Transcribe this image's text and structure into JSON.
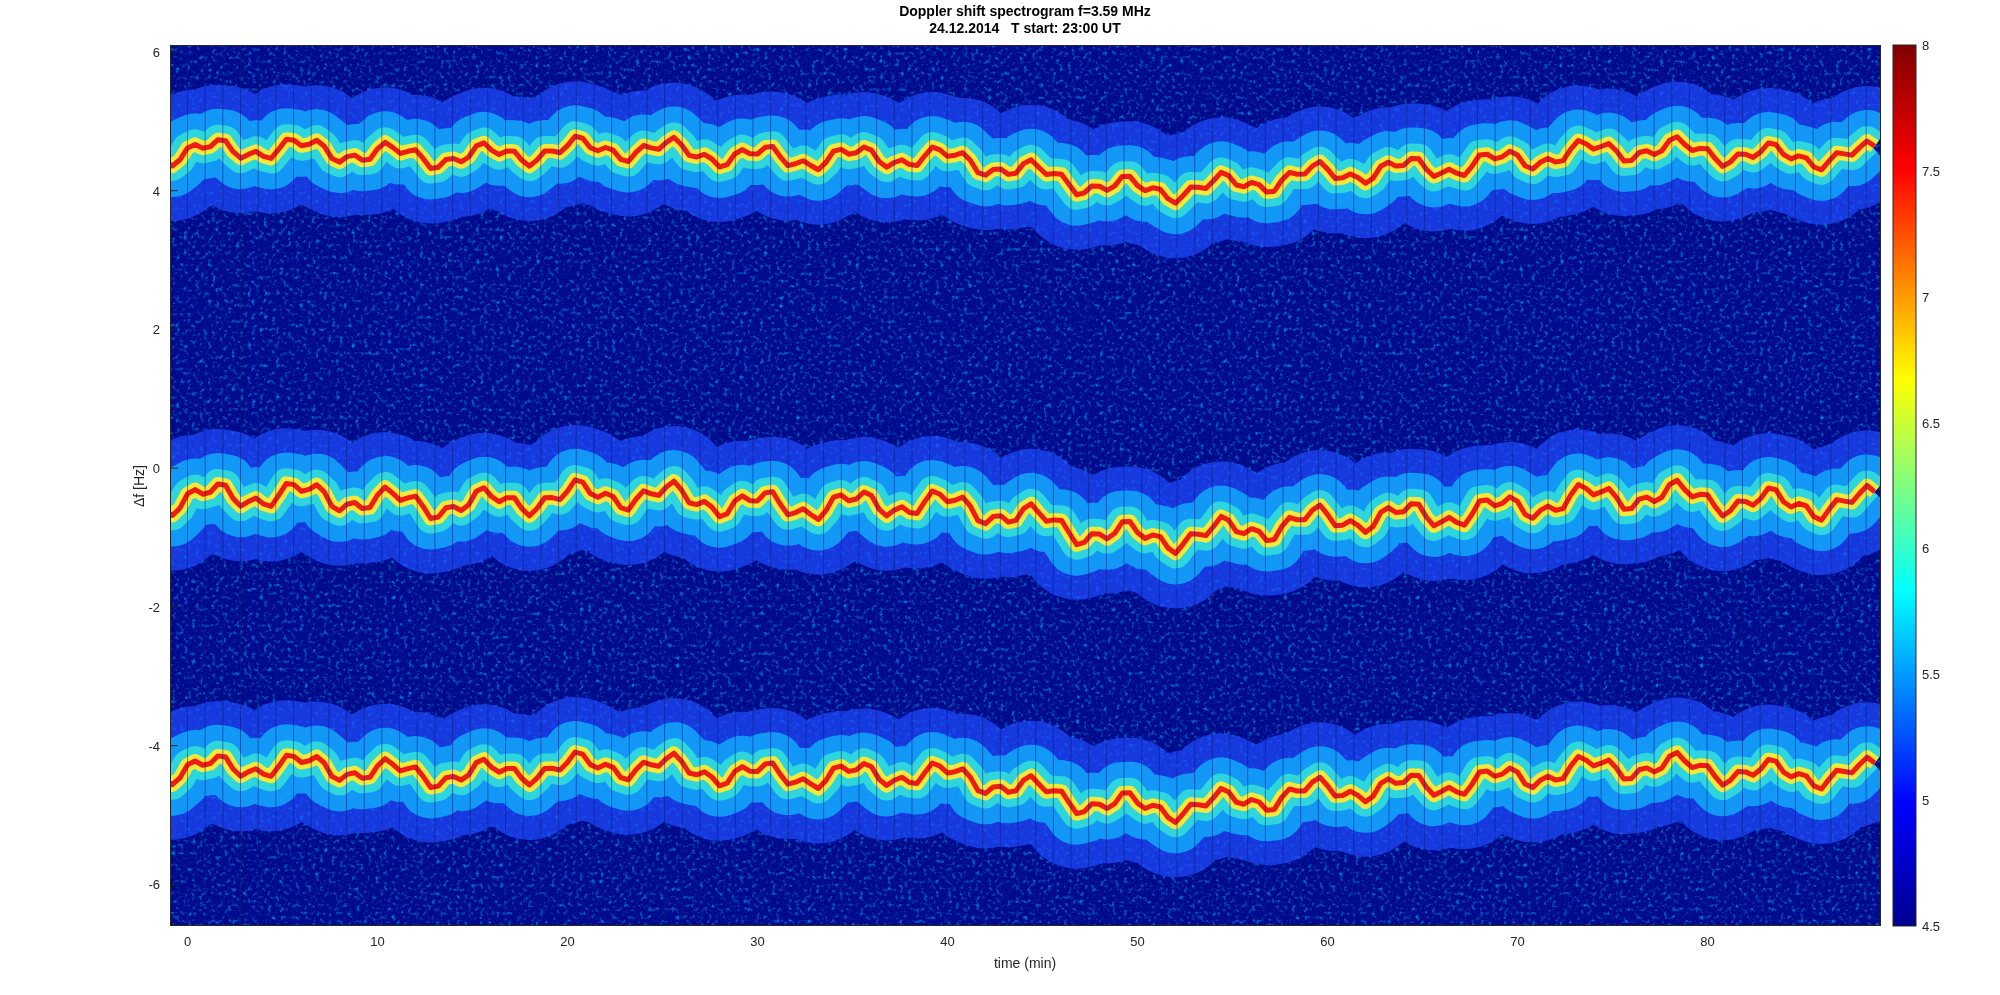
{
  "title": [
    "Doppler shift spectrogram f=3.59 MHz",
    "24.12.2014   T start: 23:00 UT"
  ],
  "y_axis": {
    "label": "Δf [Hz]",
    "ticks": [
      "6",
      "4",
      "2",
      "0",
      "-2",
      "-4",
      "-6"
    ]
  },
  "x_axis": {
    "label": "time (min)",
    "ticks": [
      "0",
      "10",
      "20",
      "30",
      "40",
      "50",
      "60",
      "70",
      "80"
    ]
  },
  "colorbar": {
    "ticks": [
      "8",
      "7.5",
      "7",
      "6.5",
      "6",
      "5.5",
      "5",
      "4.5"
    ]
  }
}
